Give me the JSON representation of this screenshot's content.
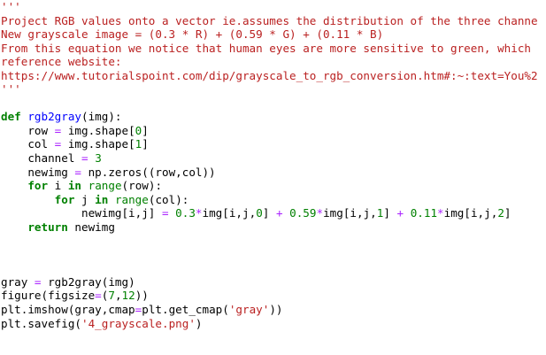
{
  "lines": [
    [
      {
        "t": "'''",
        "c": "str"
      }
    ],
    [
      {
        "t": "Project RGB values onto a vector ie.assumes the distribution of the three channe",
        "c": "str"
      }
    ],
    [
      {
        "t": "New grayscale image = (0.3 * R) + (0.59 * G) + (0.11 * B)",
        "c": "str"
      }
    ],
    [
      {
        "t": "From this equation we notice that human eyes are more sensitive to green, which",
        "c": "str"
      }
    ],
    [
      {
        "t": "reference website:",
        "c": "str"
      }
    ],
    [
      {
        "t": "https://www.tutorialspoint.com/dip/grayscale_to_rgb_conversion.htm#:~:text=You%2",
        "c": "str"
      }
    ],
    [
      {
        "t": "'''",
        "c": "str"
      }
    ],
    [],
    [
      {
        "t": "def",
        "c": "kw"
      },
      {
        "t": " ",
        "c": "plain"
      },
      {
        "t": "rgb2gray",
        "c": "fn"
      },
      {
        "t": "(img):",
        "c": "plain"
      }
    ],
    [
      {
        "t": "    row ",
        "c": "plain"
      },
      {
        "t": "=",
        "c": "op"
      },
      {
        "t": " img.shape[",
        "c": "plain"
      },
      {
        "t": "0",
        "c": "num"
      },
      {
        "t": "]",
        "c": "plain"
      }
    ],
    [
      {
        "t": "    col ",
        "c": "plain"
      },
      {
        "t": "=",
        "c": "op"
      },
      {
        "t": " img.shape[",
        "c": "plain"
      },
      {
        "t": "1",
        "c": "num"
      },
      {
        "t": "]",
        "c": "plain"
      }
    ],
    [
      {
        "t": "    channel ",
        "c": "plain"
      },
      {
        "t": "=",
        "c": "op"
      },
      {
        "t": " ",
        "c": "plain"
      },
      {
        "t": "3",
        "c": "num"
      }
    ],
    [
      {
        "t": "    newimg ",
        "c": "plain"
      },
      {
        "t": "=",
        "c": "op"
      },
      {
        "t": " np.zeros((row,col))",
        "c": "plain"
      }
    ],
    [
      {
        "t": "    ",
        "c": "plain"
      },
      {
        "t": "for",
        "c": "kw"
      },
      {
        "t": " i ",
        "c": "plain"
      },
      {
        "t": "in",
        "c": "kw"
      },
      {
        "t": " ",
        "c": "plain"
      },
      {
        "t": "range",
        "c": "builtin"
      },
      {
        "t": "(row):",
        "c": "plain"
      }
    ],
    [
      {
        "t": "        ",
        "c": "plain"
      },
      {
        "t": "for",
        "c": "kw"
      },
      {
        "t": " j ",
        "c": "plain"
      },
      {
        "t": "in",
        "c": "kw"
      },
      {
        "t": " ",
        "c": "plain"
      },
      {
        "t": "range",
        "c": "builtin"
      },
      {
        "t": "(col):",
        "c": "plain"
      }
    ],
    [
      {
        "t": "            newimg[i,j] ",
        "c": "plain"
      },
      {
        "t": "=",
        "c": "op"
      },
      {
        "t": " ",
        "c": "plain"
      },
      {
        "t": "0.3",
        "c": "num"
      },
      {
        "t": "*",
        "c": "op"
      },
      {
        "t": "img[i,j,",
        "c": "plain"
      },
      {
        "t": "0",
        "c": "num"
      },
      {
        "t": "] ",
        "c": "plain"
      },
      {
        "t": "+",
        "c": "op"
      },
      {
        "t": " ",
        "c": "plain"
      },
      {
        "t": "0.59",
        "c": "num"
      },
      {
        "t": "*",
        "c": "op"
      },
      {
        "t": "img[i,j,",
        "c": "plain"
      },
      {
        "t": "1",
        "c": "num"
      },
      {
        "t": "] ",
        "c": "plain"
      },
      {
        "t": "+",
        "c": "op"
      },
      {
        "t": " ",
        "c": "plain"
      },
      {
        "t": "0.11",
        "c": "num"
      },
      {
        "t": "*",
        "c": "op"
      },
      {
        "t": "img[i,j,",
        "c": "plain"
      },
      {
        "t": "2",
        "c": "num"
      },
      {
        "t": "]",
        "c": "plain"
      }
    ],
    [
      {
        "t": "    ",
        "c": "plain"
      },
      {
        "t": "return",
        "c": "kw"
      },
      {
        "t": " newimg",
        "c": "plain"
      }
    ],
    [],
    [],
    [],
    [
      {
        "t": "gray ",
        "c": "plain"
      },
      {
        "t": "=",
        "c": "op"
      },
      {
        "t": " rgb2gray(img)",
        "c": "plain"
      }
    ],
    [
      {
        "t": "figure(figsize",
        "c": "plain"
      },
      {
        "t": "=",
        "c": "op"
      },
      {
        "t": "(",
        "c": "plain"
      },
      {
        "t": "7",
        "c": "num"
      },
      {
        "t": ",",
        "c": "plain"
      },
      {
        "t": "12",
        "c": "num"
      },
      {
        "t": "))",
        "c": "plain"
      }
    ],
    [
      {
        "t": "plt.imshow(gray,cmap",
        "c": "plain"
      },
      {
        "t": "=",
        "c": "op"
      },
      {
        "t": "plt.get_cmap(",
        "c": "plain"
      },
      {
        "t": "'gray'",
        "c": "str"
      },
      {
        "t": "))",
        "c": "plain"
      }
    ],
    [
      {
        "t": "plt.savefig(",
        "c": "plain"
      },
      {
        "t": "'4_grayscale.png'",
        "c": "str"
      },
      {
        "t": ")",
        "c": "plain"
      }
    ]
  ],
  "colors": {
    "background": "#ffffff",
    "string": "#ba2121",
    "keyword": "#008000",
    "function_name": "#0000ff",
    "number": "#008000",
    "operator": "#aa22ff",
    "plain": "#000000"
  }
}
